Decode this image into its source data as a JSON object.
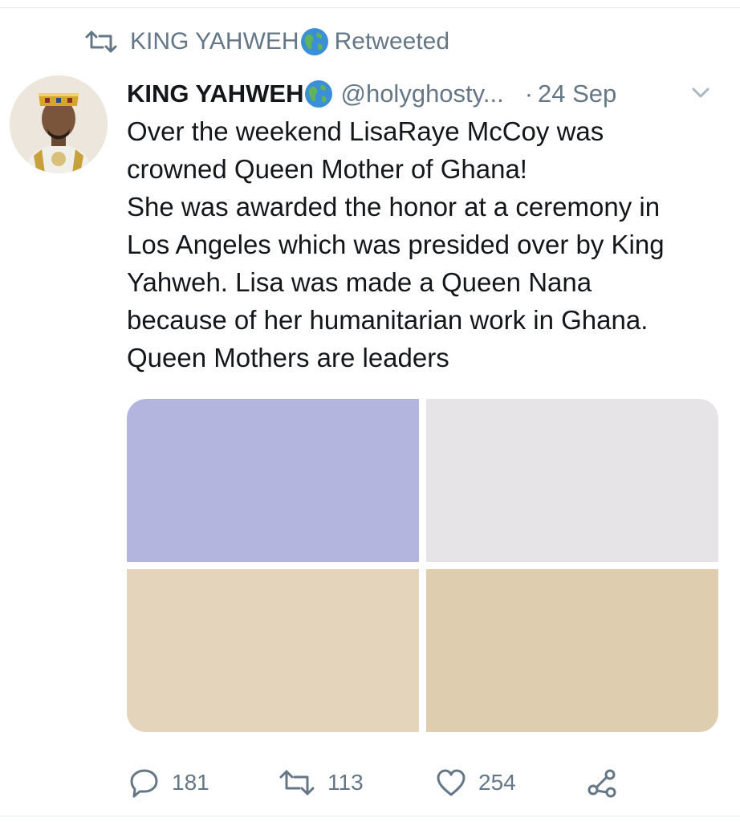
{
  "context": {
    "retweeter": "KING YAHWEH",
    "label": "Retweeted",
    "retweet_icon": "retweet-icon",
    "badge_icon": "globe-americas-emoji"
  },
  "tweet": {
    "display_name": "KING YAHWEH",
    "badge_icon": "globe-americas-emoji",
    "handle": "@holyghosty...",
    "separator": "·",
    "date": "24 Sep",
    "menu_icon": "chevron-down-icon",
    "text_lines": [
      "Over the weekend LisaRaye McCoy was",
      "crowned Queen Mother of Ghana!",
      "She was awarded the honor at a ceremony in",
      "Los Angeles which was presided over by King",
      "Yahweh. Lisa was made a Queen Nana",
      "because of her humanitarian work in Ghana.",
      "Queen Mothers are leaders"
    ],
    "media": {
      "tile_colors": [
        "#b3b5de",
        "#e7e4e7",
        "#e3d4bb",
        "#dfcdb0"
      ]
    }
  },
  "actions": {
    "replies": "181",
    "retweets": "113",
    "likes": "254",
    "icons": [
      "reply-icon",
      "retweet-icon",
      "like-icon",
      "share-icon"
    ]
  },
  "colors": {
    "text": "#14171a",
    "secondary": "#657786",
    "divider": "#e6ecf0"
  }
}
